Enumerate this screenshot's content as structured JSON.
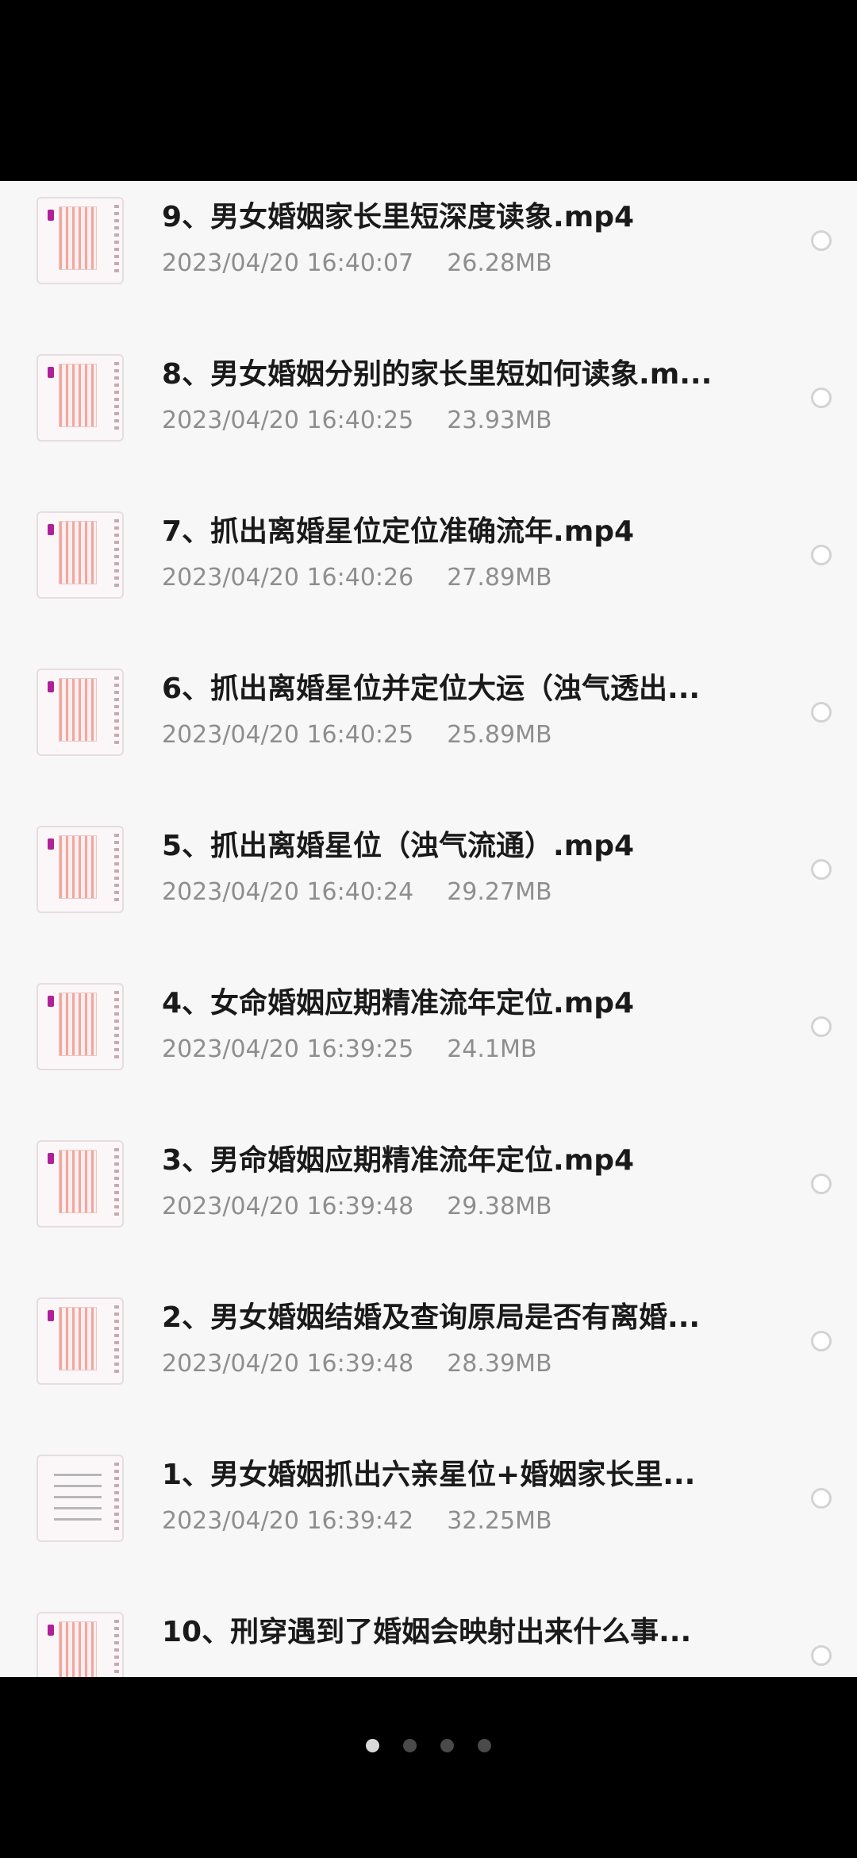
{
  "files": [
    {
      "title": "9、男女婚姻家长里短深度读象.mp4",
      "datetime": "2023/04/20 16:40:07",
      "size": "26.28MB",
      "thumb": "chart"
    },
    {
      "title": "8、男女婚姻分别的家长里短如何读象.m...",
      "datetime": "2023/04/20 16:40:25",
      "size": "23.93MB",
      "thumb": "chart"
    },
    {
      "title": "7、抓出离婚星位定位准确流年.mp4",
      "datetime": "2023/04/20 16:40:26",
      "size": "27.89MB",
      "thumb": "chart"
    },
    {
      "title": "6、抓出离婚星位并定位大运（浊气透出...",
      "datetime": "2023/04/20 16:40:25",
      "size": "25.89MB",
      "thumb": "chart"
    },
    {
      "title": "5、抓出离婚星位（浊气流通）.mp4",
      "datetime": "2023/04/20 16:40:24",
      "size": "29.27MB",
      "thumb": "chart"
    },
    {
      "title": "4、女命婚姻应期精准流年定位.mp4",
      "datetime": "2023/04/20 16:39:25",
      "size": "24.1MB",
      "thumb": "chart"
    },
    {
      "title": "3、男命婚姻应期精准流年定位.mp4",
      "datetime": "2023/04/20 16:39:48",
      "size": "29.38MB",
      "thumb": "chart"
    },
    {
      "title": "2、男女婚姻结婚及查询原局是否有离婚...",
      "datetime": "2023/04/20 16:39:48",
      "size": "28.39MB",
      "thumb": "chart"
    },
    {
      "title": "1、男女婚姻抓出六亲星位+婚姻家长里...",
      "datetime": "2023/04/20 16:39:42",
      "size": "32.25MB",
      "thumb": "doc"
    },
    {
      "title": "10、刑穿遇到了婚姻会映射出来什么事...",
      "datetime": "",
      "size": "",
      "thumb": "chart"
    }
  ],
  "pager": {
    "count": 4,
    "active_index": 0
  },
  "colors": {
    "accent_dot": "#b0209a",
    "title_text": "#1a1a1a",
    "meta_text": "#8e8e8e",
    "panel_bg": "#f7f7f7"
  }
}
